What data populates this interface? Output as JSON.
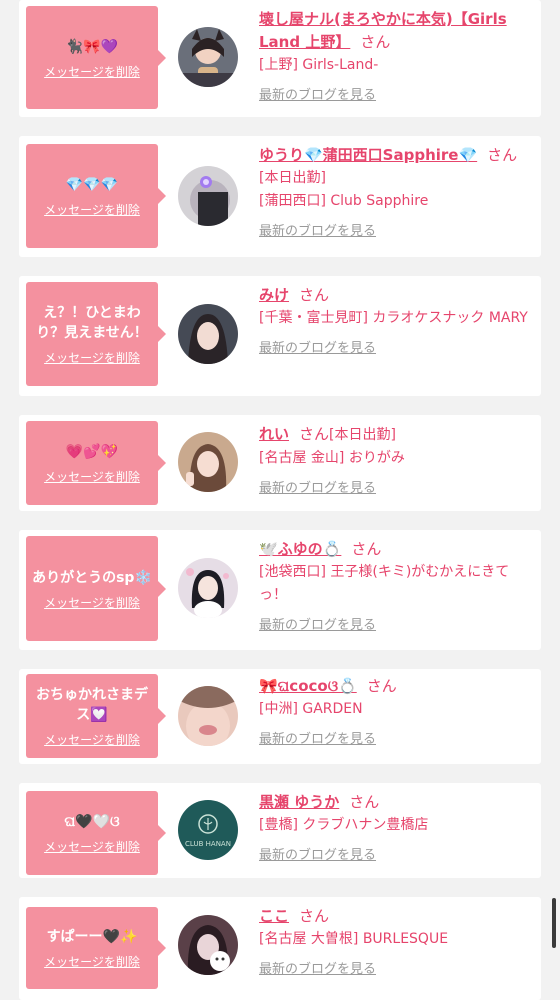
{
  "delete_label": "メッセージを削除",
  "san_label": "さん",
  "blog_label": "最新のブログを見る",
  "accent_color": "#e6456c",
  "bubble_color": "#f4919f",
  "cards": [
    {
      "bubble_text": "🐈‍⬛🎀💜",
      "name": "壊し屋ナル(まろやかに本気)【Girls Land 上野】",
      "san_inline": true,
      "extra": "",
      "shop": "[上野] Girls-Land-",
      "avatar": "a1"
    },
    {
      "bubble_text": "💎💎💎",
      "name": "ゆうり💎蒲田西口Sapphire💎",
      "san_inline": true,
      "extra": "[本日出勤]",
      "shop": "[蒲田西口] Club Sapphire",
      "avatar": "a2"
    },
    {
      "bubble_text": "え？！ひとまわり？見えません！",
      "name": "みけ",
      "san_inline": true,
      "extra": "",
      "shop": "[千葉・富士見町] カラオケスナック MARY",
      "avatar": "a3"
    },
    {
      "bubble_text": "💗💕💖",
      "name": "れい",
      "san_inline": true,
      "extra": "[本日出勤]",
      "shop": "[名古屋 金山] おりがみ",
      "avatar": "a4"
    },
    {
      "bubble_text": "ありがとうのsp❄️",
      "name": "🕊️ふゆの💍",
      "san_inline": true,
      "extra": "",
      "shop": "[池袋西口] 王子様(キミ)がむかえにきてっ！",
      "avatar": "a5"
    },
    {
      "bubble_text": "おちゅかれさまデス💟",
      "name": "🎀ଘcocoଓ💍",
      "san_inline": true,
      "extra": "",
      "shop": "[中洲] GARDEN",
      "avatar": "a6"
    },
    {
      "bubble_text": "ଘ🖤🤍ଓ",
      "name": "黒瀬 ゆうか",
      "san_inline": true,
      "extra": "",
      "shop": "[豊橋] クラブハナン豊橋店",
      "avatar": "a7"
    },
    {
      "bubble_text": "すぱーー🖤✨",
      "name": "ここ",
      "san_inline": true,
      "extra": "",
      "shop": "[名古屋 大曽根] BURLESQUE",
      "avatar": "a8"
    }
  ],
  "logo_text": "CLUB HANAN"
}
